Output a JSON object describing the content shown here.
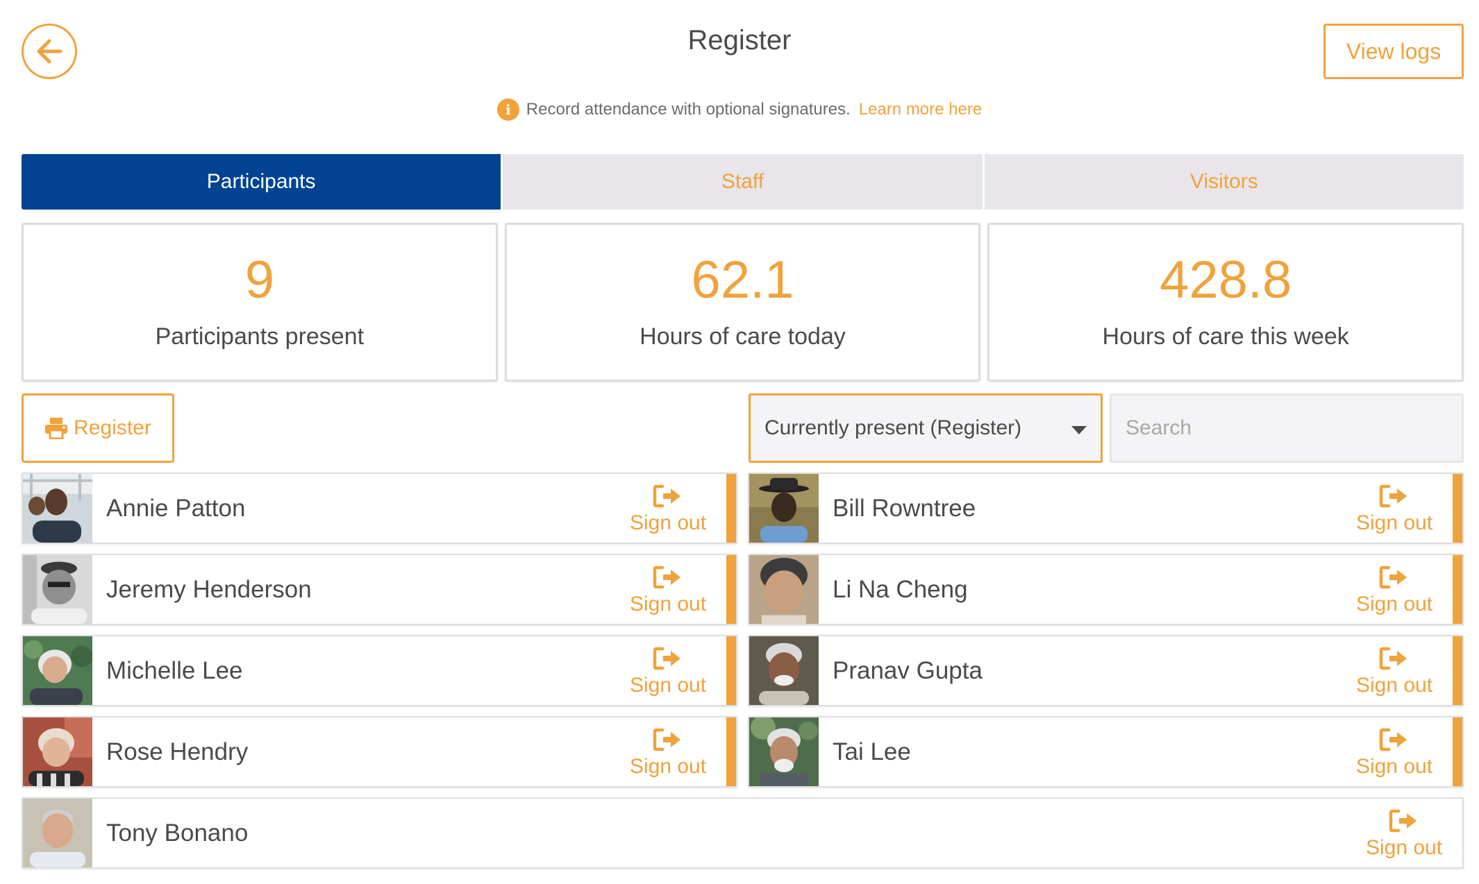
{
  "header": {
    "title": "Register",
    "view_logs_label": "View logs",
    "info_text": "Record attendance with optional signatures.",
    "learn_more_label": "Learn more here"
  },
  "tabs": [
    {
      "label": "Participants",
      "active": true
    },
    {
      "label": "Staff",
      "active": false
    },
    {
      "label": "Visitors",
      "active": false
    }
  ],
  "stats": [
    {
      "value": "9",
      "label": "Participants present"
    },
    {
      "value": "62.1",
      "label": "Hours of care today"
    },
    {
      "value": "428.8",
      "label": "Hours of care this week"
    }
  ],
  "toolbar": {
    "print_label": "Register",
    "filter_selected": "Currently present (Register)",
    "search_placeholder": "Search"
  },
  "sign_out_label": "Sign out",
  "participants": [
    {
      "name": "Annie Patton"
    },
    {
      "name": "Bill Rowntree"
    },
    {
      "name": "Jeremy Henderson"
    },
    {
      "name": "Li Na Cheng"
    },
    {
      "name": "Michelle Lee"
    },
    {
      "name": "Pranav Gupta"
    },
    {
      "name": "Rose Hendry"
    },
    {
      "name": "Tai Lee"
    },
    {
      "name": "Tony Bonano"
    }
  ],
  "colors": {
    "accent": "#f0a23b",
    "tab_active": "#004393",
    "text": "#4a4a4a"
  },
  "icons": {
    "back": "arrow-left-icon",
    "info": "info-icon",
    "print": "printer-icon",
    "sign_out": "sign-out-icon",
    "caret": "caret-down-icon"
  }
}
